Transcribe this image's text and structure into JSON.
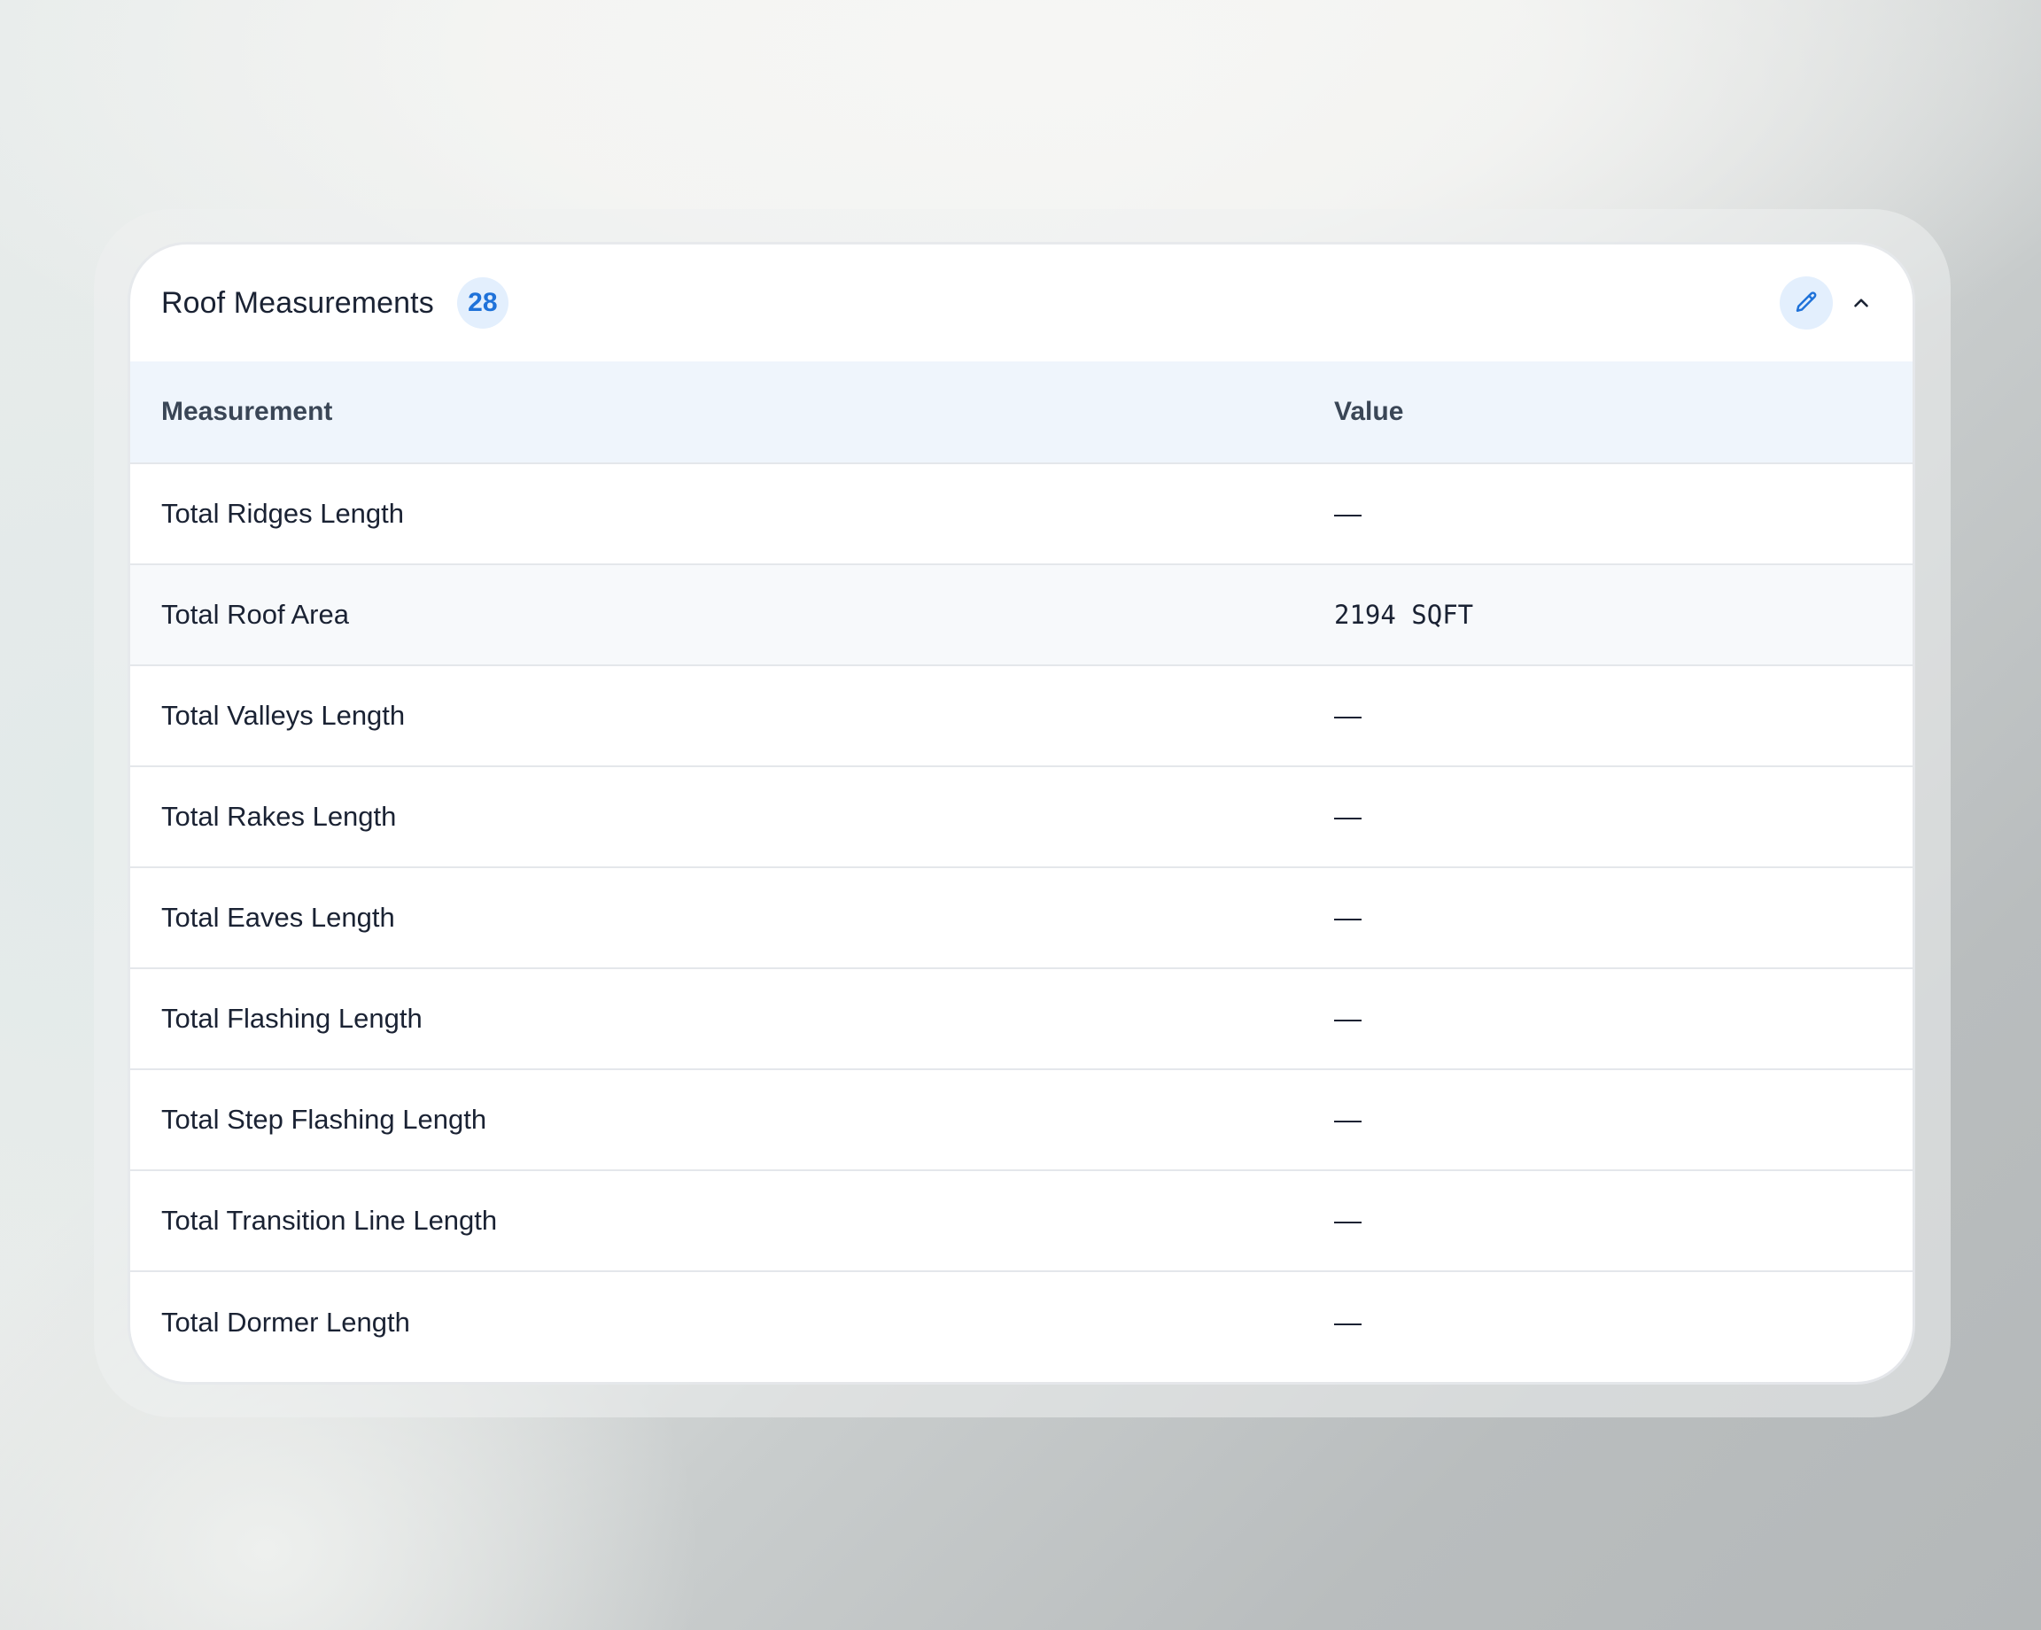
{
  "panel": {
    "title": "Roof Measurements",
    "count": "28"
  },
  "table": {
    "headers": {
      "measurement": "Measurement",
      "value": "Value"
    },
    "rows": [
      {
        "label": "Total Ridges Length",
        "value": "—"
      },
      {
        "label": "Total Roof Area",
        "value": "2194 SQFT"
      },
      {
        "label": "Total Valleys Length",
        "value": "—"
      },
      {
        "label": "Total Rakes Length",
        "value": "—"
      },
      {
        "label": "Total Eaves Length",
        "value": "—"
      },
      {
        "label": "Total Flashing Length",
        "value": "—"
      },
      {
        "label": "Total Step Flashing Length",
        "value": "—"
      },
      {
        "label": "Total Transition Line Length",
        "value": "—"
      },
      {
        "label": "Total Dormer Length",
        "value": "—"
      }
    ]
  },
  "icons": {
    "edit": "pencil-icon",
    "collapse": "chevron-up-icon"
  },
  "colors": {
    "accent": "#1f72d9",
    "badge_bg": "#e3effd",
    "header_bg": "#eff5fc"
  }
}
